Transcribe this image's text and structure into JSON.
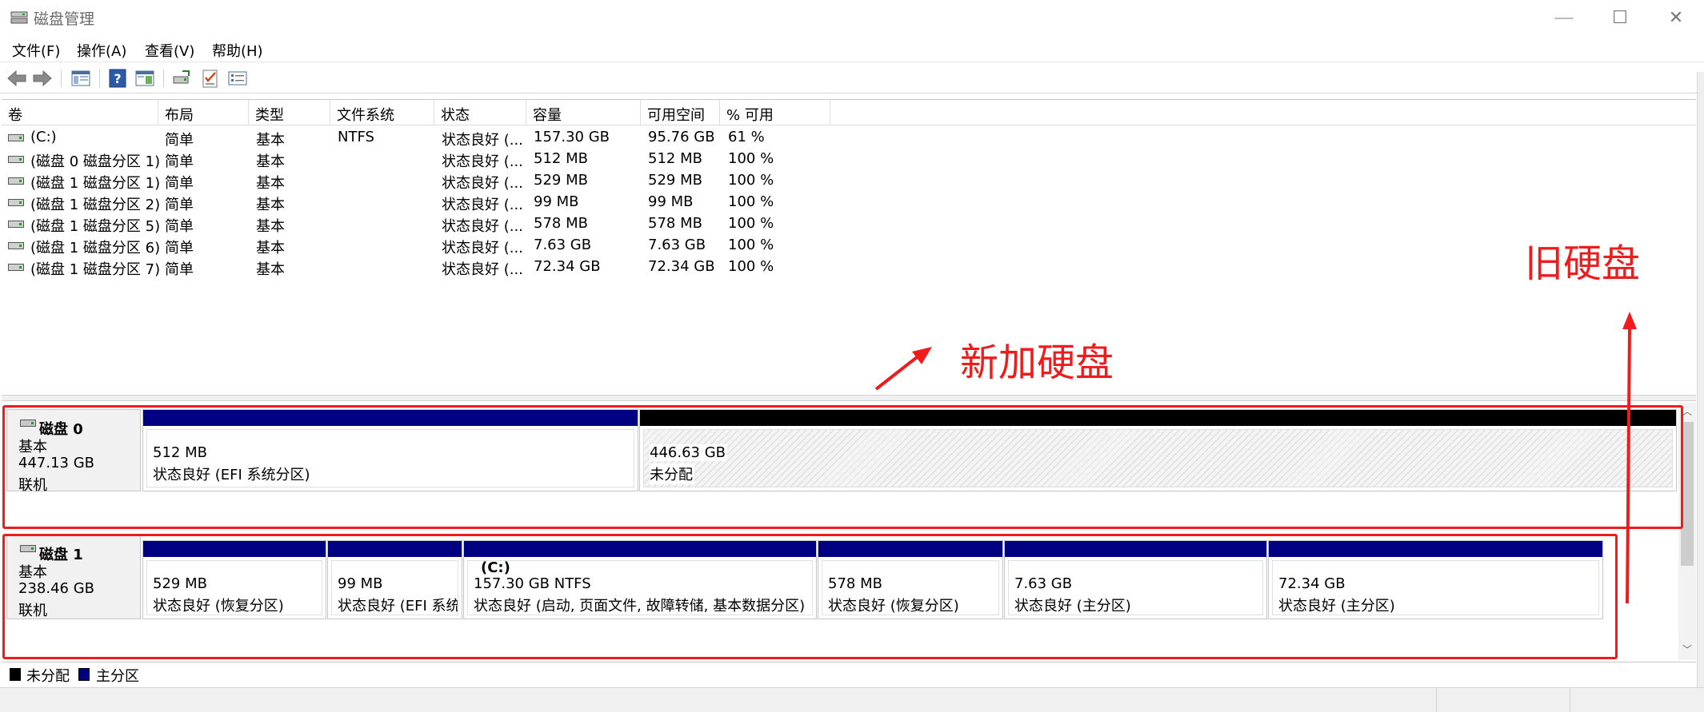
{
  "window": {
    "title": "磁盘管理",
    "minimize": "—",
    "maximize": "☐",
    "close": "✕"
  },
  "menu": [
    "文件(F)",
    "操作(A)",
    "查看(V)",
    "帮助(H)"
  ],
  "toolbar": {
    "icons": [
      "back-icon",
      "forward-icon",
      "console-tree-icon",
      "help-icon",
      "properties-view-icon",
      "connect-disk-icon",
      "checklist-icon",
      "properties-icon"
    ]
  },
  "volume_list": {
    "columns": [
      "卷",
      "布局",
      "类型",
      "文件系统",
      "状态",
      "容量",
      "可用空间",
      "% 可用"
    ],
    "rows": [
      [
        "(C:)",
        "简单",
        "基本",
        "NTFS",
        "状态良好 (...",
        "157.30 GB",
        "95.76 GB",
        "61 %"
      ],
      [
        "(磁盘 0 磁盘分区 1)",
        "简单",
        "基本",
        "",
        "状态良好 (...",
        "512 MB",
        "512 MB",
        "100 %"
      ],
      [
        "(磁盘 1 磁盘分区 1)",
        "简单",
        "基本",
        "",
        "状态良好 (...",
        "529 MB",
        "529 MB",
        "100 %"
      ],
      [
        "(磁盘 1 磁盘分区 2)",
        "简单",
        "基本",
        "",
        "状态良好 (...",
        "99 MB",
        "99 MB",
        "100 %"
      ],
      [
        "(磁盘 1 磁盘分区 5)",
        "简单",
        "基本",
        "",
        "状态良好 (...",
        "578 MB",
        "578 MB",
        "100 %"
      ],
      [
        "(磁盘 1 磁盘分区 6)",
        "简单",
        "基本",
        "",
        "状态良好 (...",
        "7.63 GB",
        "7.63 GB",
        "100 %"
      ],
      [
        "(磁盘 1 磁盘分区 7)",
        "简单",
        "基本",
        "",
        "状态良好 (...",
        "72.34 GB",
        "72.34 GB",
        "100 %"
      ]
    ]
  },
  "disks": [
    {
      "name": "磁盘 0",
      "type": "基本",
      "size": "447.13 GB",
      "state": "联机",
      "partitions": [
        {
          "label": "",
          "size": "512 MB",
          "status": "状态良好 (EFI 系统分区)",
          "kind": "primary"
        },
        {
          "label": "",
          "size": "446.63 GB",
          "status": "未分配",
          "kind": "unallocated"
        }
      ]
    },
    {
      "name": "磁盘 1",
      "type": "基本",
      "size": "238.46 GB",
      "state": "联机",
      "partitions": [
        {
          "label": "",
          "size": "529 MB",
          "status": "状态良好 (恢复分区)",
          "kind": "primary"
        },
        {
          "label": "",
          "size": "99 MB",
          "status": "状态良好 (EFI 系统",
          "kind": "primary"
        },
        {
          "label": "(C:)",
          "size": "157.30 GB NTFS",
          "status": "状态良好 (启动, 页面文件, 故障转储, 基本数据分区)",
          "kind": "primary"
        },
        {
          "label": "",
          "size": "578 MB",
          "status": "状态良好 (恢复分区)",
          "kind": "primary"
        },
        {
          "label": "",
          "size": "7.63 GB",
          "status": "状态良好 (主分区)",
          "kind": "primary"
        },
        {
          "label": "",
          "size": "72.34 GB",
          "status": "状态良好 (主分区)",
          "kind": "primary"
        }
      ]
    }
  ],
  "legend": [
    {
      "label": "未分配",
      "color": "#000000"
    },
    {
      "label": "主分区",
      "color": "#000080"
    }
  ],
  "annotations": {
    "new_disk": "新加硬盘",
    "old_disk": "旧硬盘",
    "color": "#ee1c1c"
  },
  "colors": {
    "primary_bar": "#000080",
    "unallocated_bar": "#000000"
  }
}
